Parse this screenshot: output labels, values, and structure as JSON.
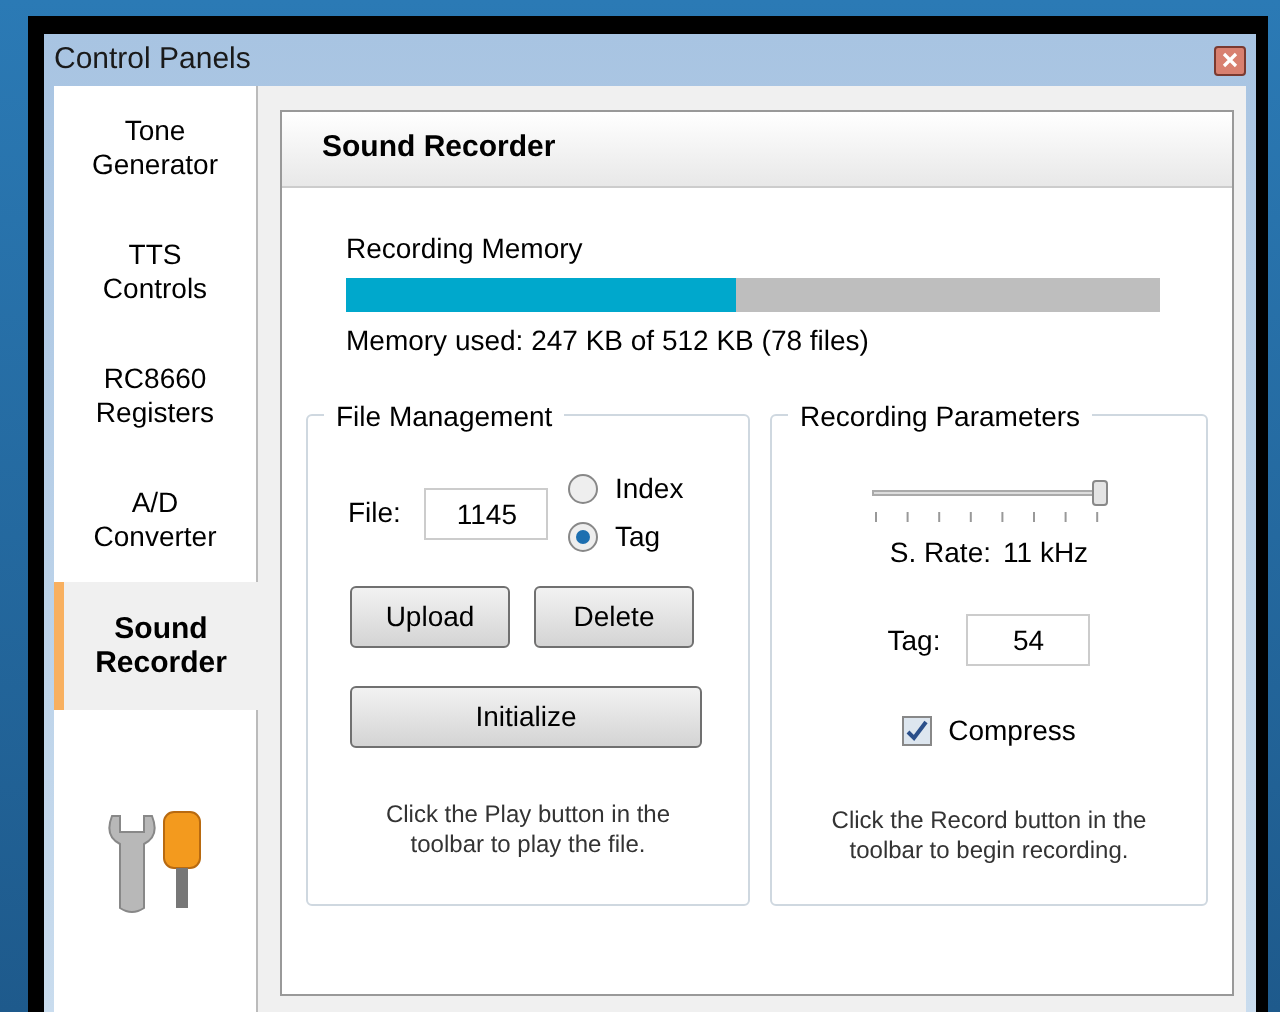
{
  "window": {
    "title": "Control Panels"
  },
  "sidebar": {
    "items": [
      {
        "label": "Tone Generator",
        "selected": false
      },
      {
        "label": "TTS Controls",
        "selected": false
      },
      {
        "label": "RC8660 Registers",
        "selected": false
      },
      {
        "label": "A/D Converter",
        "selected": false
      },
      {
        "label": "Sound Recorder",
        "selected": true
      }
    ]
  },
  "panel": {
    "title": "Sound Recorder",
    "memory": {
      "label": "Recording Memory",
      "level": 0.48,
      "reading": "Memory used: 247 KB of 512 KB (78 files)"
    },
    "file_management": {
      "title": "File Management",
      "file_label": "File:",
      "file_value": "1145",
      "radios": [
        {
          "label": "Index",
          "selected": false
        },
        {
          "label": "Tag",
          "selected": true
        }
      ],
      "buttons": [
        "Upload",
        "Delete"
      ],
      "initialize": "Initialize",
      "hint": "Click the Play button in the toolbar to play the file."
    },
    "recording_parameters": {
      "title": "Recording Parameters",
      "rate": {
        "level": 1
      },
      "rate_label": "S. Rate:",
      "rate_value": "11 kHz",
      "tag_label": "Tag:",
      "tag_value": "54",
      "compress": {
        "label": "Compress",
        "checked": true
      },
      "hint": "Click the Record button in the toolbar to begin recording."
    }
  }
}
